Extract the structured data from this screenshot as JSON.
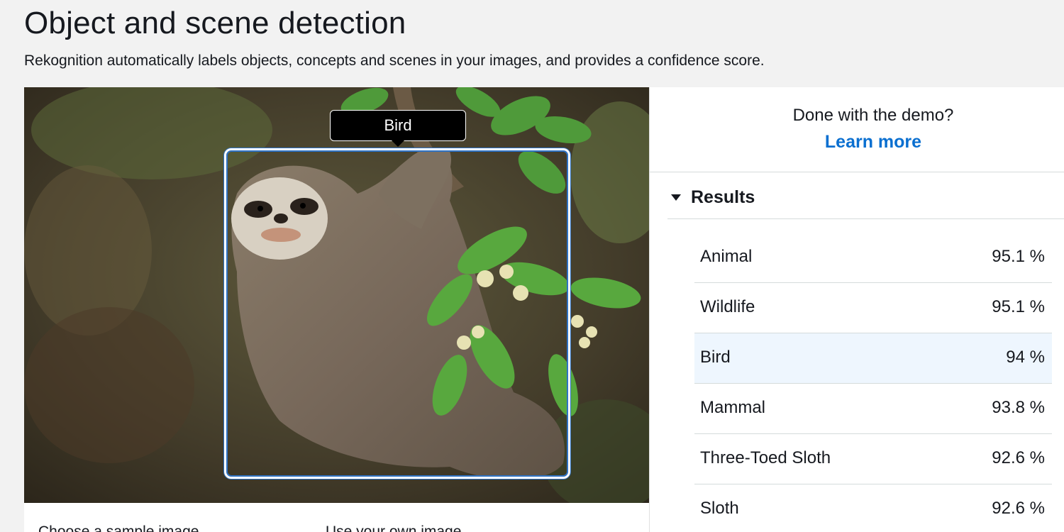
{
  "header": {
    "title": "Object and scene detection",
    "subtitle": "Rekognition automatically labels objects, concepts and scenes in your images, and provides a confidence score."
  },
  "image_panel": {
    "detection_label": "Bird",
    "box_color": "#2f73c5",
    "bottom_options": {
      "sample": "Choose a sample image",
      "own": "Use your own image"
    }
  },
  "side_panel": {
    "done_text": "Done with the demo?",
    "learn_more": "Learn more",
    "link_color": "#0a6fd0",
    "results_heading": "Results",
    "results": [
      {
        "label": "Animal",
        "score": "95.1 %"
      },
      {
        "label": "Wildlife",
        "score": "95.1 %"
      },
      {
        "label": "Bird",
        "score": "94 %",
        "selected": true
      },
      {
        "label": "Mammal",
        "score": "93.8 %"
      },
      {
        "label": "Three-Toed Sloth",
        "score": "92.6 %"
      },
      {
        "label": "Sloth",
        "score": "92.6 %"
      }
    ]
  }
}
